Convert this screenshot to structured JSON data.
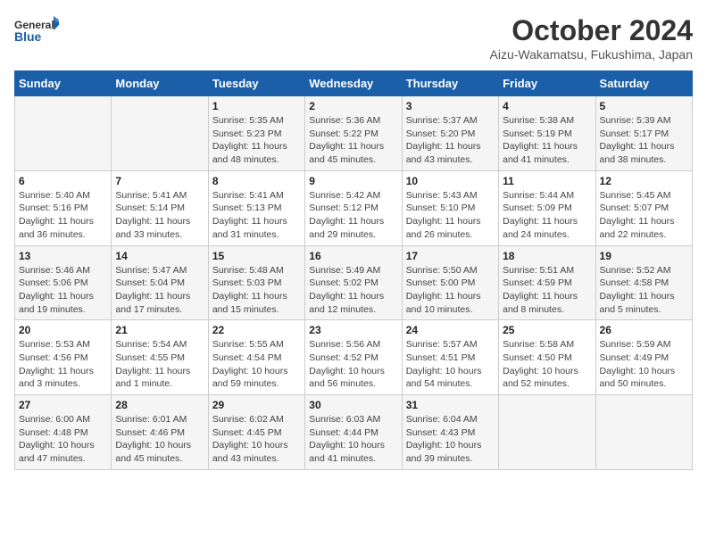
{
  "header": {
    "logo_general": "General",
    "logo_blue": "Blue",
    "month_title": "October 2024",
    "location": "Aizu-Wakamatsu, Fukushima, Japan"
  },
  "days_of_week": [
    "Sunday",
    "Monday",
    "Tuesday",
    "Wednesday",
    "Thursday",
    "Friday",
    "Saturday"
  ],
  "weeks": [
    [
      {
        "day": "",
        "info": ""
      },
      {
        "day": "",
        "info": ""
      },
      {
        "day": "1",
        "info": "Sunrise: 5:35 AM\nSunset: 5:23 PM\nDaylight: 11 hours and 48 minutes."
      },
      {
        "day": "2",
        "info": "Sunrise: 5:36 AM\nSunset: 5:22 PM\nDaylight: 11 hours and 45 minutes."
      },
      {
        "day": "3",
        "info": "Sunrise: 5:37 AM\nSunset: 5:20 PM\nDaylight: 11 hours and 43 minutes."
      },
      {
        "day": "4",
        "info": "Sunrise: 5:38 AM\nSunset: 5:19 PM\nDaylight: 11 hours and 41 minutes."
      },
      {
        "day": "5",
        "info": "Sunrise: 5:39 AM\nSunset: 5:17 PM\nDaylight: 11 hours and 38 minutes."
      }
    ],
    [
      {
        "day": "6",
        "info": "Sunrise: 5:40 AM\nSunset: 5:16 PM\nDaylight: 11 hours and 36 minutes."
      },
      {
        "day": "7",
        "info": "Sunrise: 5:41 AM\nSunset: 5:14 PM\nDaylight: 11 hours and 33 minutes."
      },
      {
        "day": "8",
        "info": "Sunrise: 5:41 AM\nSunset: 5:13 PM\nDaylight: 11 hours and 31 minutes."
      },
      {
        "day": "9",
        "info": "Sunrise: 5:42 AM\nSunset: 5:12 PM\nDaylight: 11 hours and 29 minutes."
      },
      {
        "day": "10",
        "info": "Sunrise: 5:43 AM\nSunset: 5:10 PM\nDaylight: 11 hours and 26 minutes."
      },
      {
        "day": "11",
        "info": "Sunrise: 5:44 AM\nSunset: 5:09 PM\nDaylight: 11 hours and 24 minutes."
      },
      {
        "day": "12",
        "info": "Sunrise: 5:45 AM\nSunset: 5:07 PM\nDaylight: 11 hours and 22 minutes."
      }
    ],
    [
      {
        "day": "13",
        "info": "Sunrise: 5:46 AM\nSunset: 5:06 PM\nDaylight: 11 hours and 19 minutes."
      },
      {
        "day": "14",
        "info": "Sunrise: 5:47 AM\nSunset: 5:04 PM\nDaylight: 11 hours and 17 minutes."
      },
      {
        "day": "15",
        "info": "Sunrise: 5:48 AM\nSunset: 5:03 PM\nDaylight: 11 hours and 15 minutes."
      },
      {
        "day": "16",
        "info": "Sunrise: 5:49 AM\nSunset: 5:02 PM\nDaylight: 11 hours and 12 minutes."
      },
      {
        "day": "17",
        "info": "Sunrise: 5:50 AM\nSunset: 5:00 PM\nDaylight: 11 hours and 10 minutes."
      },
      {
        "day": "18",
        "info": "Sunrise: 5:51 AM\nSunset: 4:59 PM\nDaylight: 11 hours and 8 minutes."
      },
      {
        "day": "19",
        "info": "Sunrise: 5:52 AM\nSunset: 4:58 PM\nDaylight: 11 hours and 5 minutes."
      }
    ],
    [
      {
        "day": "20",
        "info": "Sunrise: 5:53 AM\nSunset: 4:56 PM\nDaylight: 11 hours and 3 minutes."
      },
      {
        "day": "21",
        "info": "Sunrise: 5:54 AM\nSunset: 4:55 PM\nDaylight: 11 hours and 1 minute."
      },
      {
        "day": "22",
        "info": "Sunrise: 5:55 AM\nSunset: 4:54 PM\nDaylight: 10 hours and 59 minutes."
      },
      {
        "day": "23",
        "info": "Sunrise: 5:56 AM\nSunset: 4:52 PM\nDaylight: 10 hours and 56 minutes."
      },
      {
        "day": "24",
        "info": "Sunrise: 5:57 AM\nSunset: 4:51 PM\nDaylight: 10 hours and 54 minutes."
      },
      {
        "day": "25",
        "info": "Sunrise: 5:58 AM\nSunset: 4:50 PM\nDaylight: 10 hours and 52 minutes."
      },
      {
        "day": "26",
        "info": "Sunrise: 5:59 AM\nSunset: 4:49 PM\nDaylight: 10 hours and 50 minutes."
      }
    ],
    [
      {
        "day": "27",
        "info": "Sunrise: 6:00 AM\nSunset: 4:48 PM\nDaylight: 10 hours and 47 minutes."
      },
      {
        "day": "28",
        "info": "Sunrise: 6:01 AM\nSunset: 4:46 PM\nDaylight: 10 hours and 45 minutes."
      },
      {
        "day": "29",
        "info": "Sunrise: 6:02 AM\nSunset: 4:45 PM\nDaylight: 10 hours and 43 minutes."
      },
      {
        "day": "30",
        "info": "Sunrise: 6:03 AM\nSunset: 4:44 PM\nDaylight: 10 hours and 41 minutes."
      },
      {
        "day": "31",
        "info": "Sunrise: 6:04 AM\nSunset: 4:43 PM\nDaylight: 10 hours and 39 minutes."
      },
      {
        "day": "",
        "info": ""
      },
      {
        "day": "",
        "info": ""
      }
    ]
  ]
}
